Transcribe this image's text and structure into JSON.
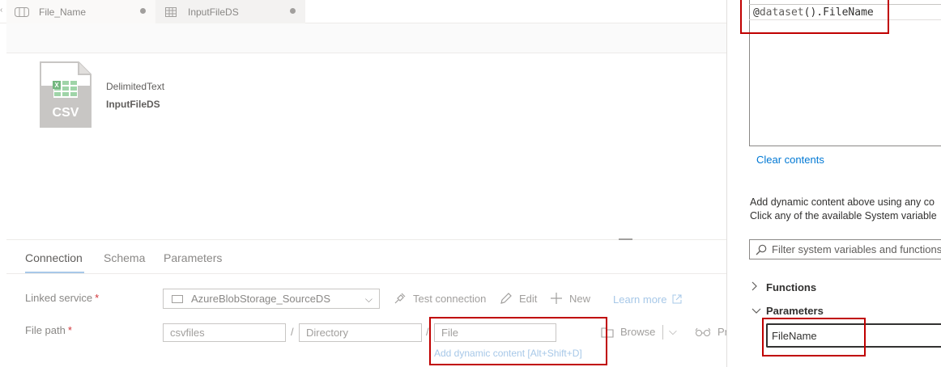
{
  "tabs": [
    {
      "label": "File_Name",
      "icon": "pipeline-icon"
    },
    {
      "label": "InputFileDS",
      "icon": "table-icon"
    }
  ],
  "dataset": {
    "icon_text": "CSV",
    "type": "DelimitedText",
    "name": "InputFileDS"
  },
  "panel_tabs": [
    "Connection",
    "Schema",
    "Parameters"
  ],
  "linked_service": {
    "label": "Linked service",
    "required_mark": "*",
    "value": "AzureBlobStorage_SourceDS",
    "test_connection": "Test connection",
    "edit": "Edit",
    "new": "New",
    "learn_more": "Learn more"
  },
  "file_path": {
    "label": "File path",
    "required_mark": "*",
    "container": "csvfiles",
    "directory_placeholder": "Directory",
    "file_placeholder": "File",
    "separator": "/",
    "dynamic_link": "Add dynamic content [Alt+Shift+D]",
    "browse": "Browse",
    "preview": "Pr"
  },
  "expression_builder": {
    "expression_prefix": "@",
    "expression_fn": "dataset",
    "expression_suffix": "().FileName",
    "clear_contents": "Clear contents",
    "help_line1": "Add dynamic content above using any co",
    "help_line2": "Click any of the available System variable",
    "filter_placeholder": "Filter system variables and functions",
    "functions_label": "Functions",
    "parameters_label": "Parameters",
    "parameter_item": "FileName"
  },
  "colors": {
    "accent": "#0078d4",
    "annotation": "#c00000",
    "csv_green": "#73b77f"
  }
}
